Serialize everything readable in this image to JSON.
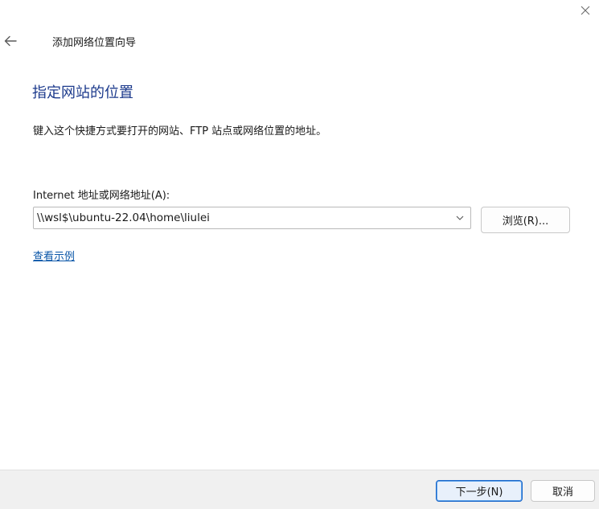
{
  "window": {
    "title": "添加网络位置向导"
  },
  "page": {
    "heading": "指定网站的位置",
    "instruction": "键入这个快捷方式要打开的网站、FTP 站点或网络位置的地址。",
    "address_label": "Internet 地址或网络地址(A):",
    "address_value": "\\\\wsl$\\ubuntu-22.04\\home\\liulei",
    "browse_label": "浏览(R)...",
    "example_link": "查看示例"
  },
  "footer": {
    "next_label": "下一步(N)",
    "cancel_label": "取消"
  },
  "icons": {
    "close": "close-icon",
    "back": "back-arrow-icon",
    "dropdown": "chevron-down-icon"
  },
  "colors": {
    "heading": "#1c3a8c",
    "link": "#0a56a8",
    "primary_border": "#1b66c9",
    "footer_bg": "#f0f0f0"
  }
}
